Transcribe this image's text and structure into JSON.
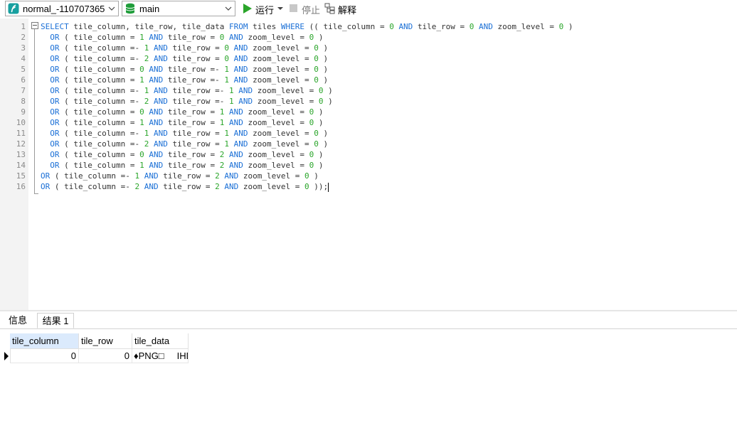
{
  "toolbar": {
    "connection": "normal_-110707365",
    "database": "main",
    "run_label": "运行",
    "stop_label": "停止",
    "explain_label": "解释",
    "colors": {
      "run_green": "#2aa52a",
      "db_green": "#1f9d3a",
      "connection_teal": "#18a0a0"
    }
  },
  "editor": {
    "line_numbers": [
      "1",
      "2",
      "3",
      "4",
      "5",
      "6",
      "7",
      "8",
      "9",
      "10",
      "11",
      "12",
      "13",
      "14",
      "15",
      "16"
    ],
    "lines": [
      "SELECT tile_column, tile_row, tile_data FROM tiles WHERE (( tile_column = 0 AND tile_row = 0 AND zoom_level = 0 )",
      "  OR ( tile_column = 1 AND tile_row = 0 AND zoom_level = 0 )",
      "  OR ( tile_column =- 1 AND tile_row = 0 AND zoom_level = 0 )",
      "  OR ( tile_column =- 2 AND tile_row = 0 AND zoom_level = 0 )",
      "  OR ( tile_column = 0 AND tile_row =- 1 AND zoom_level = 0 )",
      "  OR ( tile_column = 1 AND tile_row =- 1 AND zoom_level = 0 )",
      "  OR ( tile_column =- 1 AND tile_row =- 1 AND zoom_level = 0 )",
      "  OR ( tile_column =- 2 AND tile_row =- 1 AND zoom_level = 0 )",
      "  OR ( tile_column = 0 AND tile_row = 1 AND zoom_level = 0 )",
      "  OR ( tile_column = 1 AND tile_row = 1 AND zoom_level = 0 )",
      "  OR ( tile_column =- 1 AND tile_row = 1 AND zoom_level = 0 )",
      "  OR ( tile_column =- 2 AND tile_row = 1 AND zoom_level = 0 )",
      "  OR ( tile_column = 0 AND tile_row = 2 AND zoom_level = 0 )",
      "  OR ( tile_column = 1 AND tile_row = 2 AND zoom_level = 0 )",
      "OR ( tile_column =- 1 AND tile_row = 2 AND zoom_level = 0 )",
      "OR ( tile_column =- 2 AND tile_row = 2 AND zoom_level = 0 ));"
    ],
    "colors": {
      "keyword": "#1a6fd6",
      "number": "#2aa52a",
      "text": "#333333"
    }
  },
  "results": {
    "tabs": [
      "信息",
      "结果 1"
    ],
    "columns": [
      "tile_column",
      "tile_row",
      "tile_data"
    ],
    "rows": [
      [
        "0",
        "0",
        "♦PNG□",
        "IHD"
      ]
    ]
  }
}
